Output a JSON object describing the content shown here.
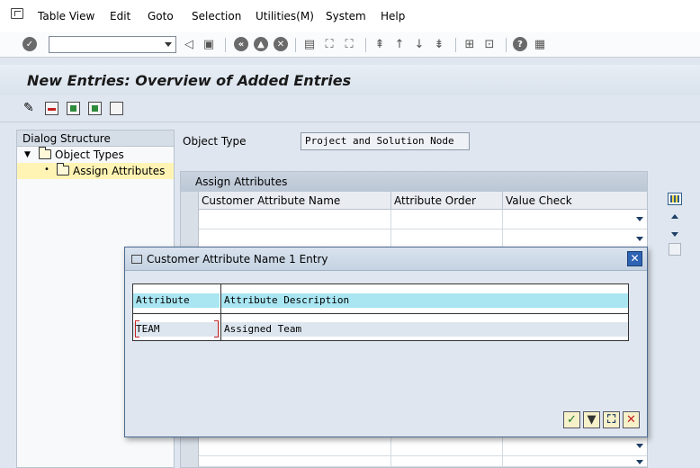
{
  "menu": [
    {
      "label": "Table View",
      "key": "T"
    },
    {
      "label": "Edit",
      "key": "E"
    },
    {
      "label": "Goto",
      "key": "G"
    },
    {
      "label": "Selection",
      "key": "S"
    },
    {
      "label": "Utilities(M)",
      "key": "U"
    },
    {
      "label": "System",
      "key": "y"
    },
    {
      "label": "Help",
      "key": "H"
    }
  ],
  "toolbar": {
    "command_field_value": "",
    "icons": [
      "enter-icon",
      "back-icon",
      "save-icon",
      "back-nav-icon",
      "exit-icon",
      "cancel-icon",
      "print-icon",
      "find-icon",
      "find-next-icon",
      "first-page-icon",
      "previous-page-icon",
      "next-page-icon",
      "last-page-icon",
      "create-session-icon",
      "shortcut-icon",
      "help-icon",
      "layout-menu-icon"
    ]
  },
  "title": "New Entries: Overview of Added Entries",
  "app_toolbar": {
    "icons": [
      "change-display-icon",
      "delete-icon",
      "select-all-icon",
      "select-block-icon",
      "deselect-all-icon"
    ]
  },
  "dialog_structure": {
    "header": "Dialog Structure",
    "items": [
      {
        "label": "Object Types",
        "expanded": true,
        "selected": false
      },
      {
        "label": "Assign Attributes",
        "expanded": false,
        "selected": true
      }
    ]
  },
  "object_type": {
    "label": "Object Type",
    "value": "Project and Solution Node"
  },
  "table": {
    "caption": "Assign Attributes",
    "columns": [
      "Customer Attribute Name",
      "Attribute Order",
      "Value Check"
    ]
  },
  "popup": {
    "title": "Customer Attribute Name 1 Entry",
    "close_label": "✕",
    "columns": [
      "Attribute",
      "Attribute Description"
    ],
    "rows": [
      {
        "attribute": "TEAM",
        "description": "Assigned Team"
      }
    ],
    "buttons": [
      "confirm-icon",
      "filter-icon",
      "find-icon",
      "cancel-icon"
    ]
  },
  "colors": {
    "background": "#dfe6ef",
    "header_highlight": "#a9e6f2",
    "selection_yellow": "#fff4b3",
    "close_blue": "#2d63b3"
  }
}
